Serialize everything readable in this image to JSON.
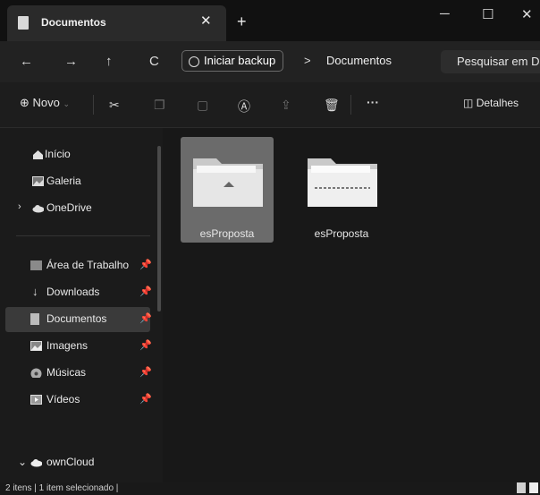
{
  "tab": {
    "title": "Documentos"
  },
  "window": {
    "minimize": "─",
    "maximize": "☐",
    "close": "✕",
    "new_tab": "+",
    "tab_close": "✕"
  },
  "nav": {
    "back": "←",
    "forward": "→",
    "up": "↑",
    "refresh": "C",
    "backup_label": "Iniciar backup",
    "separator": ">",
    "breadcrumb": "Documentos",
    "search_placeholder": "Pesquisar em D"
  },
  "toolbar": {
    "new_label": "Novo",
    "more": "···",
    "details_label": "Detalhes"
  },
  "sidebar": {
    "items": [
      {
        "label": "Início",
        "icon": "home-icon"
      },
      {
        "label": "Galeria",
        "icon": "gallery-icon"
      },
      {
        "label": "OneDrive",
        "icon": "cloud-icon"
      },
      {
        "label": "Área de Trabalho",
        "icon": "desktop-icon",
        "pinned": true
      },
      {
        "label": "Downloads",
        "icon": "download-icon",
        "pinned": true
      },
      {
        "label": "Documentos",
        "icon": "documents-icon",
        "pinned": true,
        "selected": true
      },
      {
        "label": "Imagens",
        "icon": "pictures-icon",
        "pinned": true
      },
      {
        "label": "Músicas",
        "icon": "music-icon",
        "pinned": true
      },
      {
        "label": "Vídeos",
        "icon": "videos-icon",
        "pinned": true
      },
      {
        "label": "ownCloud",
        "icon": "cloud-icon"
      }
    ]
  },
  "files": [
    {
      "name": "esProposta",
      "type": "folder-pdf",
      "selected": true
    },
    {
      "name": "esProposta",
      "type": "folder-zip",
      "selected": false
    }
  ],
  "status": {
    "text": "2 itens  |  1 item selecionado  |"
  },
  "colors": {
    "background": "#191919",
    "selected": "#6b6b6b",
    "sidebar_selected": "#3a3a3a"
  }
}
